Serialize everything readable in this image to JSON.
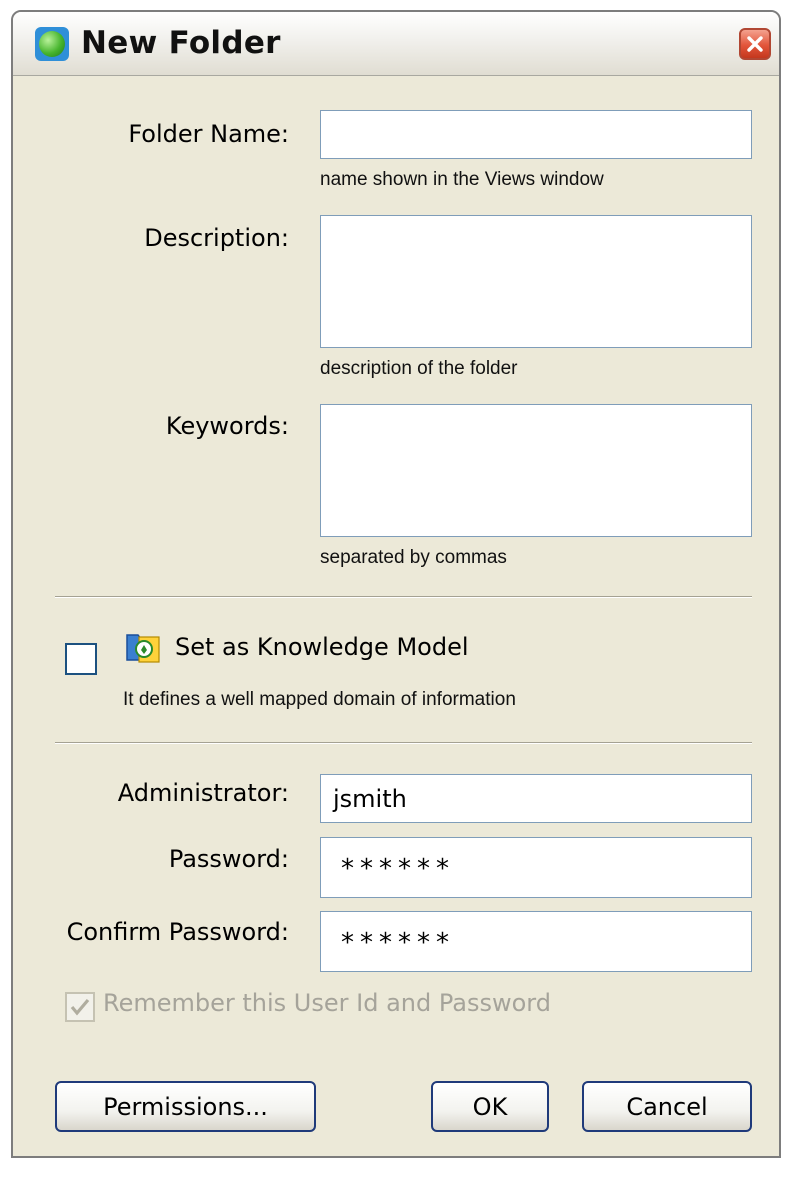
{
  "window": {
    "title": "New Folder"
  },
  "form": {
    "folder_name": {
      "label": "Folder Name:",
      "value": "",
      "hint": "name shown in the Views window"
    },
    "description": {
      "label": "Description:",
      "value": "",
      "hint": "description of the folder"
    },
    "keywords": {
      "label": "Keywords:",
      "value": "",
      "hint": "separated by commas"
    }
  },
  "knowledge_model": {
    "checked": false,
    "label": "Set as Knowledge Model",
    "description": "It defines a well mapped domain of information"
  },
  "credentials": {
    "administrator": {
      "label": "Administrator:",
      "value": "jsmith"
    },
    "password": {
      "label": "Password:",
      "value": "******"
    },
    "confirm_password": {
      "label": "Confirm Password:",
      "value": "******"
    },
    "remember": {
      "label": "Remember this User Id and Password",
      "checked": true,
      "disabled": true
    }
  },
  "buttons": {
    "permissions": "Permissions...",
    "ok": "OK",
    "cancel": "Cancel"
  },
  "colors": {
    "field_border": "#7f9db9",
    "dialog_bg": "#ece9d8",
    "close_red": "#e2553a",
    "disabled_text": "#a5a39a"
  },
  "icons": [
    "app-globe-icon",
    "close-icon",
    "knowledge-model-icon",
    "checkmark-icon"
  ]
}
